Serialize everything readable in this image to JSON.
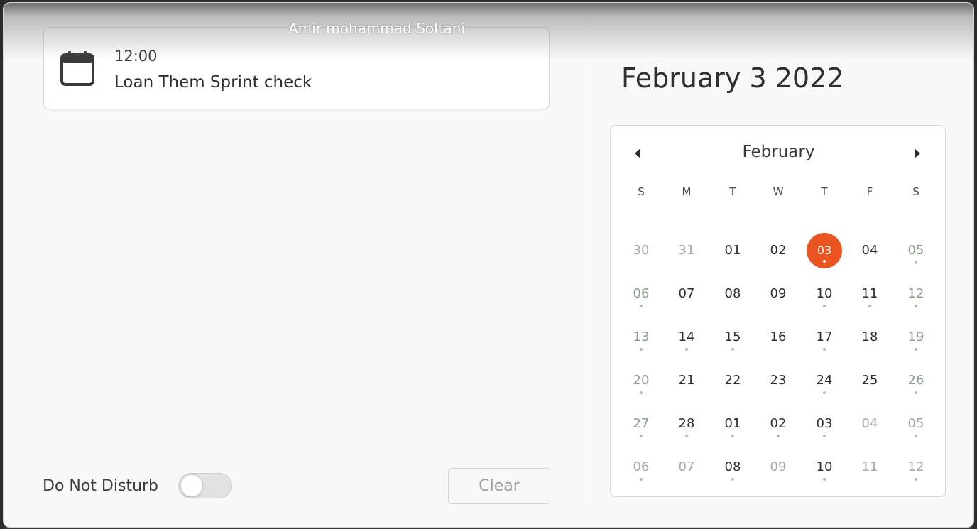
{
  "tooltip": "Amir mohammad Soltani",
  "event": {
    "time": "12:00",
    "title": "Loan Them Sprint check",
    "icon": "calendar-icon"
  },
  "dnd": {
    "label": "Do Not Disturb",
    "enabled": false
  },
  "clear_label": "Clear",
  "date_title": "February 3 2022",
  "calendar": {
    "month": "February",
    "weekdays": [
      "S",
      "M",
      "T",
      "W",
      "T",
      "F",
      "S"
    ],
    "today_color": "#e95420",
    "weeks": [
      [
        {
          "d": "30",
          "other": true,
          "dot": false
        },
        {
          "d": "31",
          "other": true,
          "dot": false
        },
        {
          "d": "01",
          "dot": false
        },
        {
          "d": "02",
          "dot": false
        },
        {
          "d": "03",
          "today": true,
          "dot": true
        },
        {
          "d": "04",
          "dot": false
        },
        {
          "d": "05",
          "weekend": true,
          "dot": true
        }
      ],
      [
        {
          "d": "06",
          "weekend": true,
          "dot": true
        },
        {
          "d": "07",
          "dot": false
        },
        {
          "d": "08",
          "dot": false
        },
        {
          "d": "09",
          "dot": false
        },
        {
          "d": "10",
          "dot": true
        },
        {
          "d": "11",
          "dot": true
        },
        {
          "d": "12",
          "weekend": true,
          "dot": true
        }
      ],
      [
        {
          "d": "13",
          "weekend": true,
          "dot": true
        },
        {
          "d": "14",
          "dot": true
        },
        {
          "d": "15",
          "dot": true
        },
        {
          "d": "16",
          "dot": false
        },
        {
          "d": "17",
          "dot": true
        },
        {
          "d": "18",
          "dot": false
        },
        {
          "d": "19",
          "weekend": true,
          "dot": true
        }
      ],
      [
        {
          "d": "20",
          "weekend": true,
          "dot": true
        },
        {
          "d": "21",
          "dot": false
        },
        {
          "d": "22",
          "dot": false
        },
        {
          "d": "23",
          "dot": false
        },
        {
          "d": "24",
          "dot": true
        },
        {
          "d": "25",
          "dot": false
        },
        {
          "d": "26",
          "weekend": true,
          "dot": true
        }
      ],
      [
        {
          "d": "27",
          "weekend": true,
          "dot": true
        },
        {
          "d": "28",
          "dot": true
        },
        {
          "d": "01",
          "dot": true
        },
        {
          "d": "02",
          "dot": true
        },
        {
          "d": "03",
          "dot": true
        },
        {
          "d": "04",
          "other": true,
          "dot": false
        },
        {
          "d": "05",
          "other": true,
          "dot": true
        }
      ],
      [
        {
          "d": "06",
          "other": true,
          "dot": true
        },
        {
          "d": "07",
          "other": true,
          "dot": false
        },
        {
          "d": "08",
          "dot": true
        },
        {
          "d": "09",
          "other": true,
          "dot": false
        },
        {
          "d": "10",
          "dot": true
        },
        {
          "d": "11",
          "other": true,
          "dot": false
        },
        {
          "d": "12",
          "other": true,
          "dot": true
        }
      ]
    ]
  }
}
